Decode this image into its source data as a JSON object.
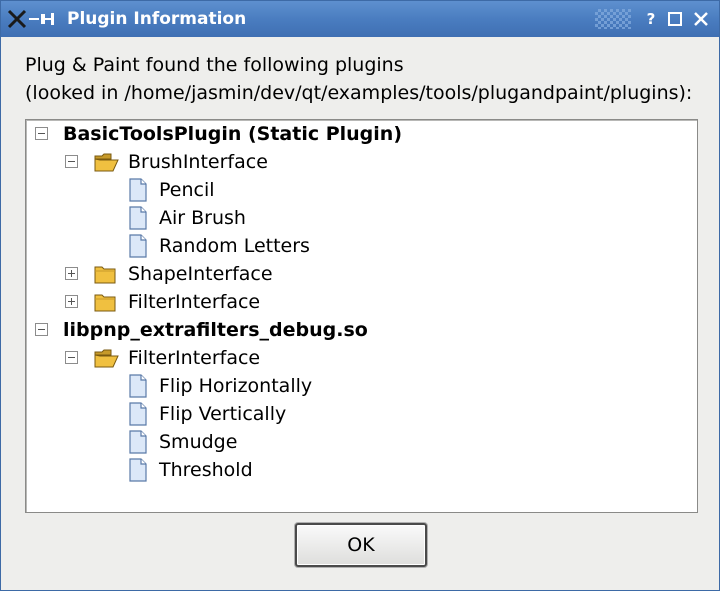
{
  "window": {
    "title": "Plugin Information",
    "buttons": {
      "help": "?",
      "maximize": "□",
      "close": "✕"
    }
  },
  "intro": {
    "line1": "Plug & Paint found the following plugins",
    "line2": "(looked in /home/jasmin/dev/qt/examples/tools/plugandpaint/plugins):"
  },
  "tree": {
    "items": [
      {
        "label": "BasicToolsPlugin (Static Plugin)",
        "expander": "minus",
        "icon": "none"
      },
      {
        "label": "BrushInterface",
        "expander": "minus",
        "icon": "open-folder-icon"
      },
      {
        "label": "Pencil",
        "expander": "none",
        "icon": "file-icon"
      },
      {
        "label": "Air Brush",
        "expander": "none",
        "icon": "file-icon"
      },
      {
        "label": "Random Letters",
        "expander": "none",
        "icon": "file-icon"
      },
      {
        "label": "ShapeInterface",
        "expander": "plus",
        "icon": "folder-icon"
      },
      {
        "label": "FilterInterface",
        "expander": "plus",
        "icon": "folder-icon"
      },
      {
        "label": "libpnp_extrafilters_debug.so",
        "expander": "minus",
        "icon": "none"
      },
      {
        "label": "FilterInterface",
        "expander": "minus",
        "icon": "open-folder-icon"
      },
      {
        "label": "Flip Horizontally",
        "expander": "none",
        "icon": "file-icon"
      },
      {
        "label": "Flip Vertically",
        "expander": "none",
        "icon": "file-icon"
      },
      {
        "label": "Smudge",
        "expander": "none",
        "icon": "file-icon"
      },
      {
        "label": "Threshold",
        "expander": "none",
        "icon": "file-icon"
      }
    ]
  },
  "ok_button": {
    "label": "OK"
  },
  "colors": {
    "titlebar": "#4a7dc0",
    "folder": "#f0c040",
    "file": "#dce8f8"
  }
}
